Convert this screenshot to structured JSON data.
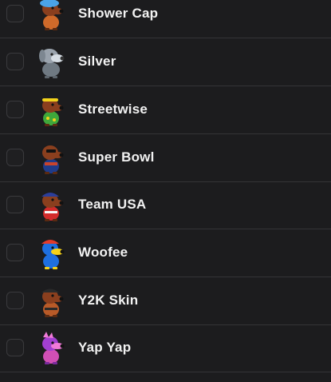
{
  "skins": [
    {
      "name": "Shower Cap",
      "icon": "dog-shower-cap-icon",
      "colors": {
        "body": "#8a3f1e",
        "accent": "#4aa3e8",
        "outfit": "#d06a2a"
      }
    },
    {
      "name": "Silver",
      "icon": "dog-silver-icon",
      "colors": {
        "body": "#9aa3ad",
        "accent": "#d6dde4",
        "outfit": "#6f7982"
      }
    },
    {
      "name": "Streetwise",
      "icon": "dog-streetwise-icon",
      "colors": {
        "body": "#8a3f1e",
        "accent": "#f2d21b",
        "outfit": "#3fa83b"
      }
    },
    {
      "name": "Super Bowl",
      "icon": "dog-super-bowl-icon",
      "colors": {
        "body": "#8a3f1e",
        "accent": "#1f3b8a",
        "outfit": "#c8442c"
      }
    },
    {
      "name": "Team USA",
      "icon": "dog-team-usa-icon",
      "colors": {
        "body": "#8a3f1e",
        "accent": "#2b3e9a",
        "outfit": "#d22b2b"
      }
    },
    {
      "name": "Woofee",
      "icon": "dog-woofee-icon",
      "colors": {
        "body": "#1e6fe0",
        "accent": "#f5d21a",
        "outfit": "#e23b2b"
      }
    },
    {
      "name": "Y2K Skin",
      "icon": "dog-y2k-skin-icon",
      "colors": {
        "body": "#8a3f1e",
        "accent": "#2a2a2a",
        "outfit": "#b85a28"
      }
    },
    {
      "name": "Yap Yap",
      "icon": "dog-yap-yap-icon",
      "colors": {
        "body": "#a23fd1",
        "accent": "#f07ad8",
        "outfit": "#d14fb5"
      }
    }
  ]
}
